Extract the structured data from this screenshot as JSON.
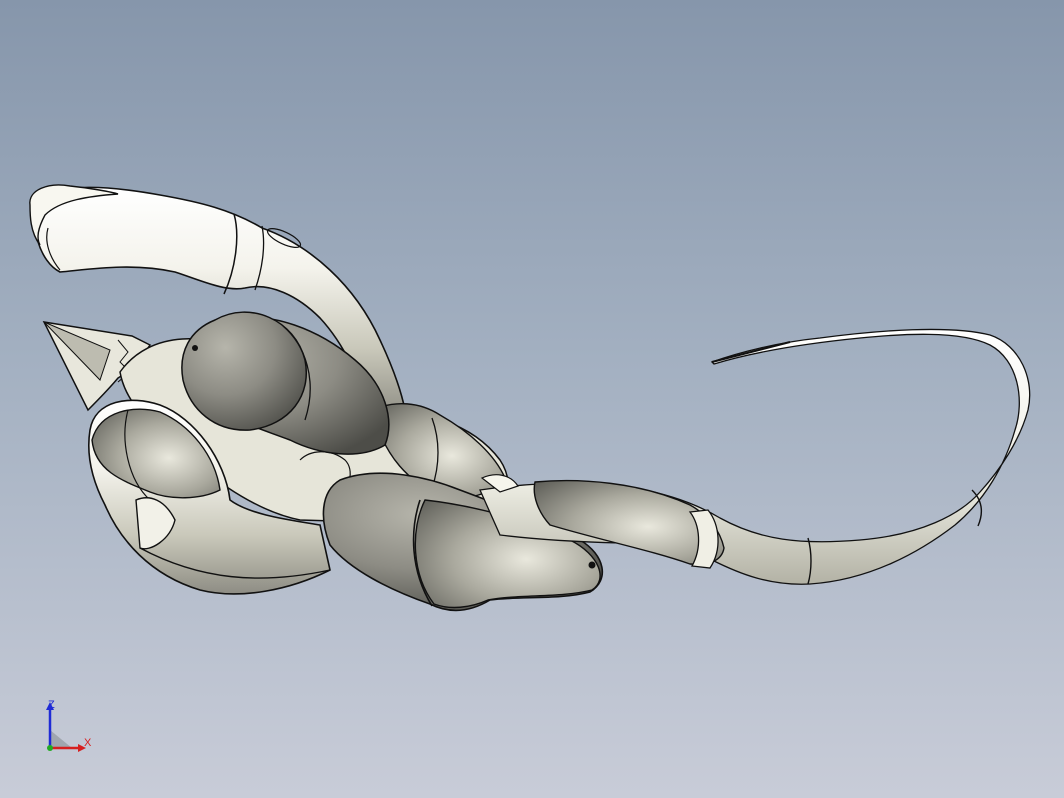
{
  "viewport": {
    "background_top": "#8696ab",
    "background_bottom": "#c8ccd8"
  },
  "model": {
    "shade_light": "#f4f3ec",
    "shade_mid": "#bdbcae",
    "shade_dark": "#6f6f68",
    "edge_color": "#111111"
  },
  "triad": {
    "z_label": "Z",
    "x_label": "X",
    "z_color": "#1f2bd6",
    "x_color": "#d61f1f",
    "y_color": "#22aa22"
  }
}
